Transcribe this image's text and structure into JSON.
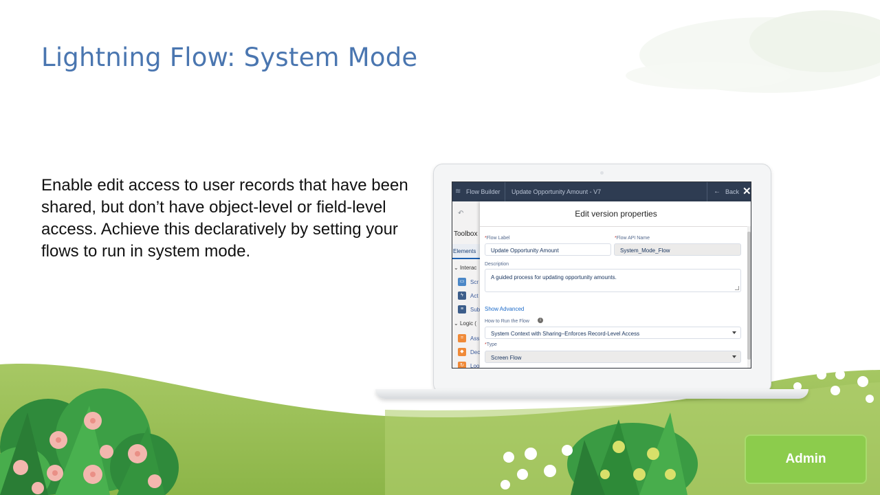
{
  "slide": {
    "title": "Lightning Flow: System Mode",
    "body": "Enable edit access to user records that have been shared, but don’t have object-level or field-level access. Achieve this declaratively by setting your flows to run in system mode."
  },
  "flow_builder": {
    "app_name": "Flow Builder",
    "flow_title": "Update Opportunity Amount - V7",
    "back_label": "Back",
    "close_glyph": "✕",
    "toolbox_label": "Toolbox",
    "elements_tab": "Elements",
    "sections": {
      "interaction": "Interac",
      "logic": "Logic ("
    },
    "items": [
      "Scr",
      "Act",
      "Sub",
      "Ass",
      "Dec",
      "Loo"
    ],
    "item_colors": [
      "#4b87c7",
      "#3c5d8a",
      "#3c5d8a",
      "#f08a38",
      "#f08a38",
      "#f08a38"
    ]
  },
  "modal": {
    "title": "Edit version properties",
    "flow_label": {
      "label": "Flow Label",
      "required_mark": "*",
      "value": "Update Opportunity Amount"
    },
    "api_name": {
      "label": "Flow API Name",
      "required_mark": "*",
      "value": "System_Mode_Flow"
    },
    "description": {
      "label": "Description",
      "value": "A guided process for updating opportunity amounts."
    },
    "show_advanced": "Show Advanced",
    "run_mode": {
      "label": "How to Run the Flow",
      "value": "System Context with Sharing–Enforces Record-Level Access"
    },
    "type": {
      "label": "Type",
      "required_mark": "*",
      "value": "Screen Flow"
    }
  },
  "badge": {
    "label": "Admin"
  },
  "colors": {
    "title": "#4a76b0",
    "topbar": "#2e3c52",
    "grass": "#9bc25a",
    "admin_button": "#8ccc4c"
  }
}
